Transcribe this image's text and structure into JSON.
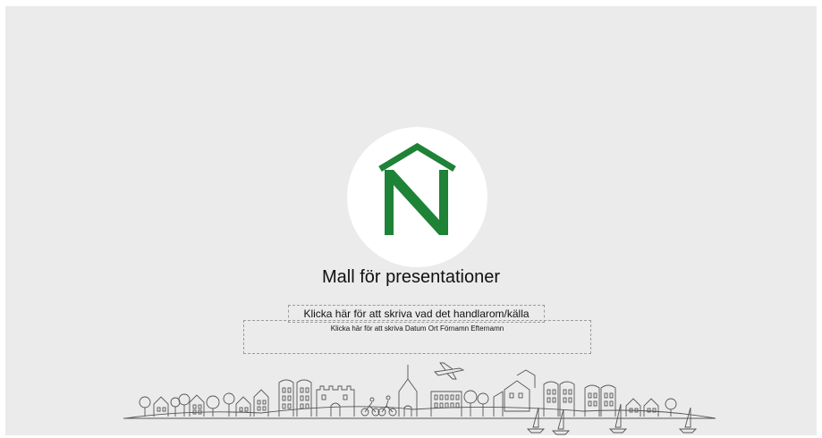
{
  "slide": {
    "title": "Mall för presentationer",
    "subtitle_placeholder": "Klicka här för att skriva vad det handlarom/källa",
    "info_placeholder": "Klicka här för att skriva Datum Ort Förnamn Efternamn"
  },
  "logo": {
    "icon": "house-n-logo-icon",
    "color": "#1e8237"
  },
  "illustration": {
    "icon": "city-skyline-icon",
    "stroke_color": "#555555"
  }
}
